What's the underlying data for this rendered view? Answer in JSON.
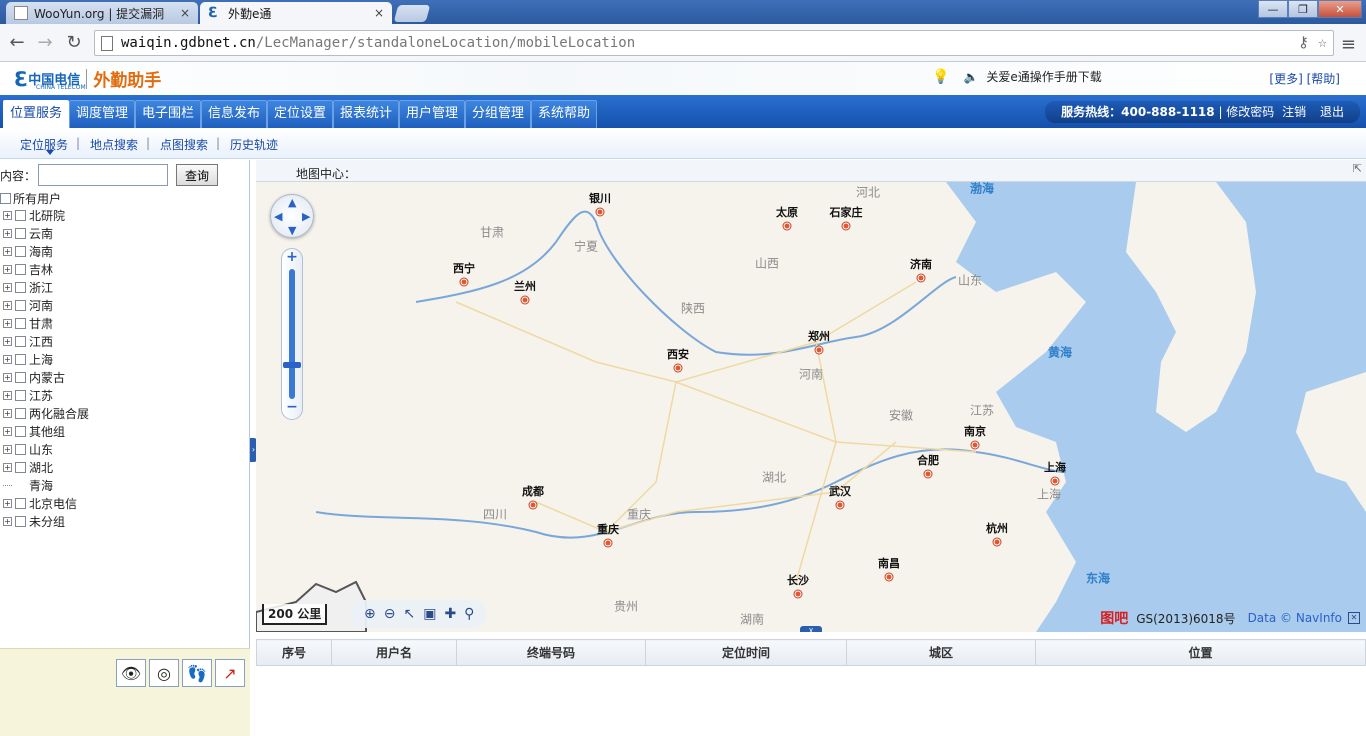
{
  "browser": {
    "tabs": [
      {
        "label": "WooYun.org | 提交漏洞",
        "close": "×"
      },
      {
        "label": "外勤e通",
        "close": "×"
      }
    ],
    "address": {
      "host": "waiqin.gdbnet.cn",
      "path": "/LecManager/standaloneLocation/mobileLocation"
    },
    "window_buttons": [
      "—",
      "❐",
      "✕"
    ]
  },
  "header": {
    "logo_cn": "中国电信",
    "logo_en": "CHINA TELECOM",
    "app_name": "外勤助手",
    "notice": "关爱e通操作手册下载",
    "more": "[更多]",
    "help": "[帮助]"
  },
  "nav": {
    "items": [
      "位置服务",
      "调度管理",
      "电子围栏",
      "信息发布",
      "定位设置",
      "报表统计",
      "用户管理",
      "分组管理",
      "系统帮助"
    ],
    "hotline_label": "服务热线：400-888-1118",
    "change_password": "修改密码",
    "logout": "注销",
    "exit": "退出"
  },
  "subnav": {
    "items": [
      "定位服务",
      "地点搜索",
      "点图搜索",
      "历史轨迹"
    ]
  },
  "search": {
    "label": "内容：",
    "value": "",
    "button": "查询"
  },
  "tree": {
    "root": "所有用户",
    "groups": [
      {
        "name": "北研院",
        "expandable": true
      },
      {
        "name": "云南",
        "expandable": true
      },
      {
        "name": "海南",
        "expandable": true
      },
      {
        "name": "吉林",
        "expandable": true
      },
      {
        "name": "浙江",
        "expandable": true
      },
      {
        "name": "河南",
        "expandable": true
      },
      {
        "name": "甘肃",
        "expandable": true
      },
      {
        "name": "江西",
        "expandable": true
      },
      {
        "name": "上海",
        "expandable": true
      },
      {
        "name": "内蒙古",
        "expandable": true
      },
      {
        "name": "江苏",
        "expandable": true
      },
      {
        "name": "两化融合展",
        "expandable": true
      },
      {
        "name": "其他组",
        "expandable": true
      },
      {
        "name": "山东",
        "expandable": true
      },
      {
        "name": "湖北",
        "expandable": true
      },
      {
        "name": "青海",
        "expandable": false
      },
      {
        "name": "北京电信",
        "expandable": true
      },
      {
        "name": "未分组",
        "expandable": true
      }
    ]
  },
  "map": {
    "center_label": "地图中心：",
    "scale": "200 公里",
    "brand": "图吧",
    "license": "GS(2013)6018号",
    "data_credit": "Data © NavInfo",
    "cities": [
      {
        "name": "银川"
      },
      {
        "name": "太原"
      },
      {
        "name": "石家庄"
      },
      {
        "name": "西宁"
      },
      {
        "name": "兰州"
      },
      {
        "name": "济南"
      },
      {
        "name": "郑州"
      },
      {
        "name": "西安"
      },
      {
        "name": "南京"
      },
      {
        "name": "合肥"
      },
      {
        "name": "上海"
      },
      {
        "name": "成都"
      },
      {
        "name": "武汉"
      },
      {
        "name": "重庆"
      },
      {
        "name": "杭州"
      },
      {
        "name": "长沙"
      },
      {
        "name": "南昌"
      }
    ],
    "provinces": [
      "河北",
      "甘肃",
      "宁夏",
      "山西",
      "山东",
      "陕西",
      "河南",
      "安徽",
      "江苏",
      "湖北",
      "四川",
      "重庆",
      "上海",
      "贵州",
      "湖南"
    ],
    "seas": [
      "渤海",
      "黄海",
      "东海"
    ]
  },
  "table": {
    "headers": [
      "序号",
      "用户名",
      "终端号码",
      "定位时间",
      "城区",
      "位置"
    ]
  }
}
